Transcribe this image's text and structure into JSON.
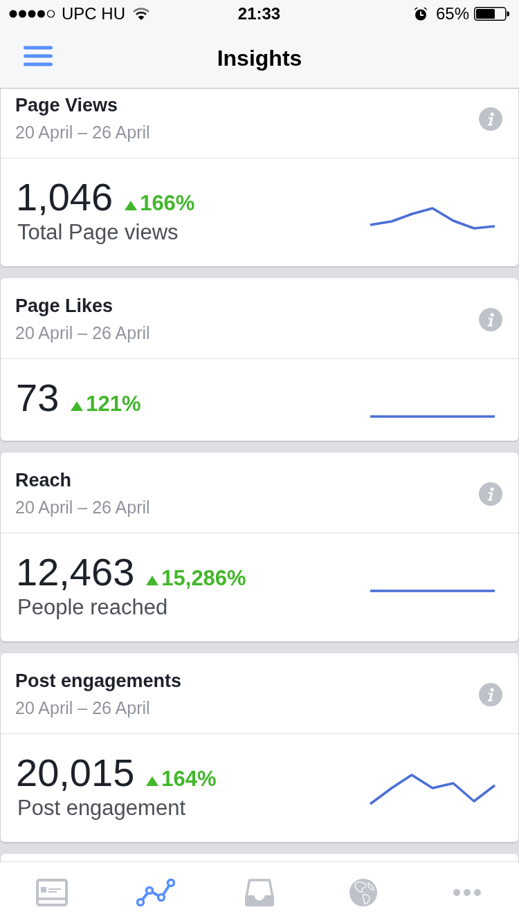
{
  "status_bar": {
    "carrier": "UPC HU",
    "time": "21:33",
    "battery": "65%"
  },
  "nav_bar": {
    "title": "Insights"
  },
  "cards": [
    {
      "title": "Page Views",
      "date": "20 April – 26 April",
      "value": "1,046",
      "change": {
        "rising": true,
        "text": "166%"
      },
      "label": "Total Page views"
    },
    {
      "title": "Page Likes",
      "date": "20 April – 26 April",
      "value": "73",
      "change": {
        "rising": true,
        "text": "121%"
      }
    },
    {
      "title": "Reach",
      "date": "20 April – 26 April",
      "value": "12,463",
      "change": {
        "rising": true,
        "text": "15,286%"
      },
      "label": "People reached"
    },
    {
      "title": "Post engagements",
      "date": "20 April – 26 April",
      "value": "20,015",
      "change": {
        "rising": true,
        "text": "164%"
      },
      "label": "Post engagement"
    }
  ],
  "tab_bar": {
    "tabs": [
      {
        "selected": false
      },
      {
        "selected": true
      },
      {
        "selected": false
      },
      {
        "selected": false
      },
      {
        "selected": false
      }
    ]
  }
}
